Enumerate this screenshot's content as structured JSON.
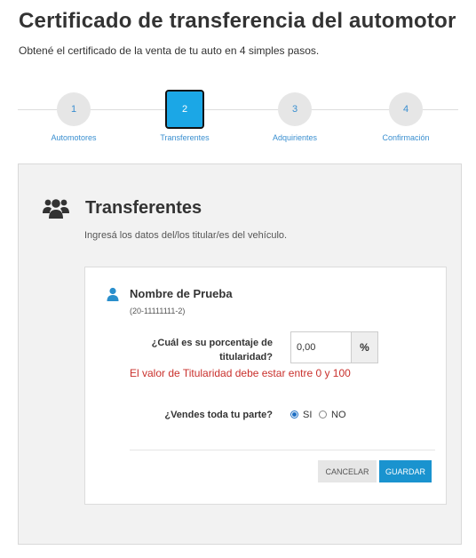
{
  "header": {
    "title": "Certificado de transferencia del automotor",
    "subtitle": "Obtené el certificado de la venta de tu auto en 4 simples pasos."
  },
  "stepper": {
    "active_step": 2,
    "steps": [
      {
        "number": "1",
        "label": "Automotores"
      },
      {
        "number": "2",
        "label": "Transferentes"
      },
      {
        "number": "3",
        "label": "Adquirientes"
      },
      {
        "number": "4",
        "label": "Confirmación"
      }
    ]
  },
  "section": {
    "icon": "users-group-icon",
    "title": "Transferentes",
    "description": "Ingresá los datos del/los titular/es del vehículo."
  },
  "person": {
    "icon": "user-icon",
    "name": "Nombre de Prueba",
    "cuit": "(20-11111111-2)"
  },
  "form": {
    "percentage_label": "¿Cuál es su porcentaje de titularidad?",
    "percentage_value": "0,00",
    "percentage_addon": "%",
    "error_message": "El valor de Titularidad debe estar entre 0 y 100",
    "sell_all_label": "¿Vendes toda tu parte?",
    "sell_all_options": [
      {
        "label": "SI",
        "checked": true
      },
      {
        "label": "NO",
        "checked": false
      }
    ]
  },
  "actions": {
    "cancel_label": "CANCELAR",
    "save_label": "GUARDAR"
  },
  "colors": {
    "accent": "#1ba7e6",
    "primary_button": "#1a93cf",
    "error": "#c9302c",
    "step_label": "#3a8fd0"
  }
}
